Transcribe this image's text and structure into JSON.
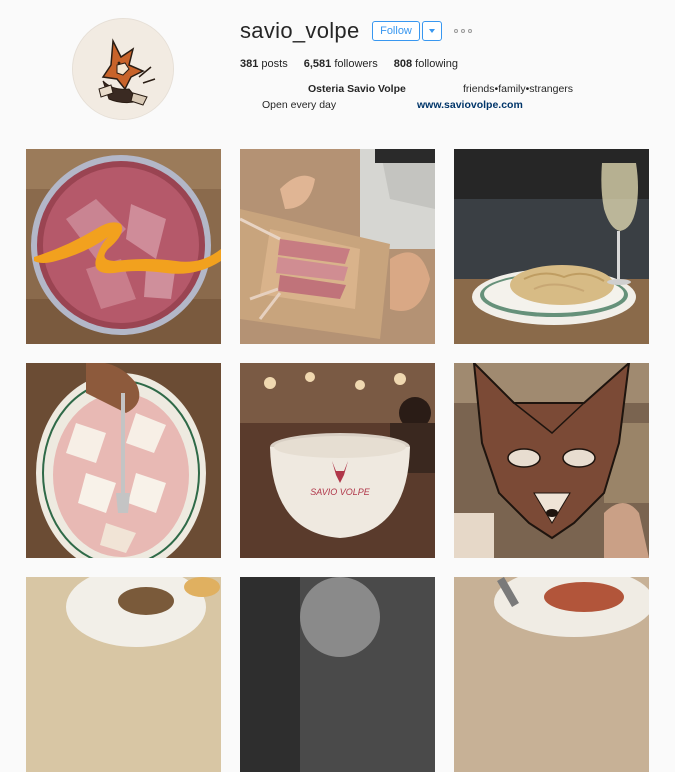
{
  "profile": {
    "username": "savio_volpe",
    "follow_label": "Follow",
    "avatar_icon": "fox-illustration-icon",
    "stats": {
      "posts_count": "381",
      "posts_label": "posts",
      "followers_count": "6,581",
      "followers_label": "followers",
      "following_count": "808",
      "following_label": "following"
    },
    "bio": {
      "name": "Osteria Savio Volpe",
      "tagline": "friends•family•strangers",
      "hours": "Open every day",
      "website": "www.saviovolpe.com"
    }
  },
  "posts": [
    {
      "subject": "cocktail-with-orange-peel"
    },
    {
      "subject": "lamb-chops-on-board"
    },
    {
      "subject": "pasta-with-white-wine"
    },
    {
      "subject": "prosciutto-plate"
    },
    {
      "subject": "savio-volpe-cup"
    },
    {
      "subject": "fox-mask"
    },
    {
      "subject": "food-partial"
    },
    {
      "subject": "portrait-partial"
    },
    {
      "subject": "dish-partial"
    }
  ],
  "cup_text": "SAVIO VOLPE",
  "colors": {
    "accent": "#3897f0",
    "link": "#003569"
  }
}
